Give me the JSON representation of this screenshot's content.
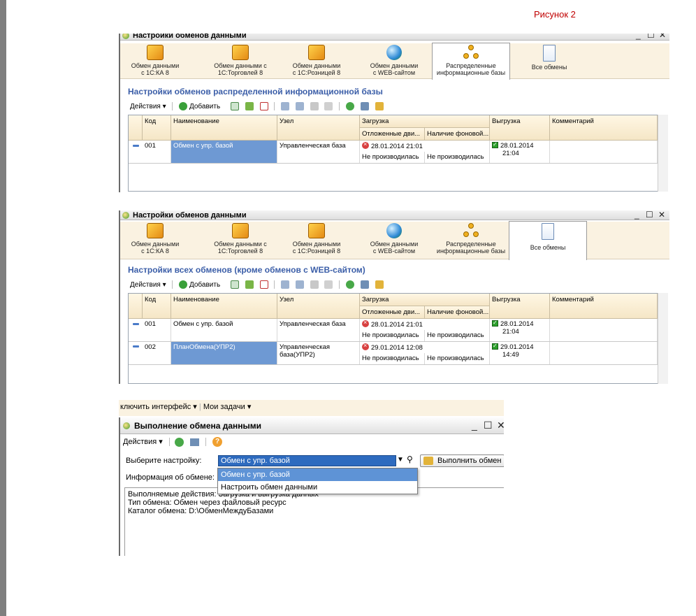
{
  "figure_caption": "Рисунок 2",
  "win1": {
    "title": "Настройки обменов данными",
    "tabs": [
      {
        "line1": "Обмен данными",
        "line2": "с 1С:КА 8"
      },
      {
        "line1": "Обмен данными с",
        "line2": "1С:Торговлей 8"
      },
      {
        "line1": "Обмен данными",
        "line2": "с 1С:Розницей 8"
      },
      {
        "line1": "Обмен данными",
        "line2": "с WEB-сайтом"
      },
      {
        "line1": "Распределенные",
        "line2": "информационные базы"
      },
      {
        "line1": "",
        "line2": "Все обмены"
      }
    ],
    "section_title": "Настройки обменов распределенной информационной базы",
    "toolbar": {
      "actions": "Действия ▾",
      "add": "Добавить"
    },
    "columns": {
      "code": "Код",
      "name": "Наименование",
      "node": "Узел",
      "load": "Загрузка",
      "load_deferred": "Отложенные дви...",
      "load_bg": "Наличие фоновой...",
      "unload": "Выгрузка",
      "comment": "Комментарий"
    },
    "rows": [
      {
        "code": "001",
        "name": "Обмен с упр. базой",
        "node": "Управленческая база",
        "load_date": "28.01.2014 21:01",
        "load_status1": "Не производилась",
        "load_status2": "Не производилась",
        "unload_date": "28.01.2014",
        "unload_time": "21:04"
      }
    ]
  },
  "win2": {
    "title": "Настройки обменов данными",
    "tabs": [
      {
        "line1": "Обмен данными",
        "line2": "с 1С:КА 8"
      },
      {
        "line1": "Обмен данными с",
        "line2": "1С:Торговлей 8"
      },
      {
        "line1": "Обмен данными",
        "line2": "с 1С:Розницей 8"
      },
      {
        "line1": "Обмен данными",
        "line2": "с WEB-сайтом"
      },
      {
        "line1": "Распределенные",
        "line2": "информационные базы"
      },
      {
        "line1": "",
        "line2": "Все обмены"
      }
    ],
    "section_title": "Настройки всех обменов (кроме обменов с WEB-сайтом)",
    "toolbar": {
      "actions": "Действия ▾",
      "add": "Добавить"
    },
    "columns": {
      "code": "Код",
      "name": "Наименование",
      "node": "Узел",
      "load": "Загрузка",
      "load_deferred": "Отложенные дви...",
      "load_bg": "Наличие фоновой...",
      "unload": "Выгрузка",
      "comment": "Комментарий"
    },
    "rows": [
      {
        "code": "001",
        "name": "Обмен с упр. базой",
        "node": "Управленческая база",
        "node2": "",
        "load_date": "28.01.2014 21:01",
        "load_status1": "Не производилась",
        "load_status2": "Не производилась",
        "unload_date": "28.01.2014",
        "unload_time": "21:04"
      },
      {
        "code": "002",
        "name": "ПланОбмена(УПР2)",
        "node": "Управленческая",
        "node2": "база(УПР2)",
        "load_date": "29.01.2014 12:08",
        "load_status1": "Не производилась",
        "load_status2": "Не производилась",
        "unload_date": "29.01.2014",
        "unload_time": "14:49"
      }
    ]
  },
  "menubar": {
    "item1": "ключить интерфейс ▾",
    "item2": "Мои задачи"
  },
  "exec": {
    "title": "Выполнение обмена данными",
    "actions": "Действия ▾",
    "choose_label": "Выберите настройку:",
    "selected": "Обмен с упр. базой",
    "run_button": "Выполнить обмен",
    "dropdown_items": [
      "Обмен с упр. базой",
      "Настроить обмен данными"
    ],
    "info_label": "Информация об обмене:",
    "info_lines": [
      "Выполняемые действия: Загрузка и выгрузка данных",
      "Тип обмена:  Обмен через файловый ресурс",
      "Каталог обмена: D:\\ОбменМеждуБазами"
    ]
  }
}
